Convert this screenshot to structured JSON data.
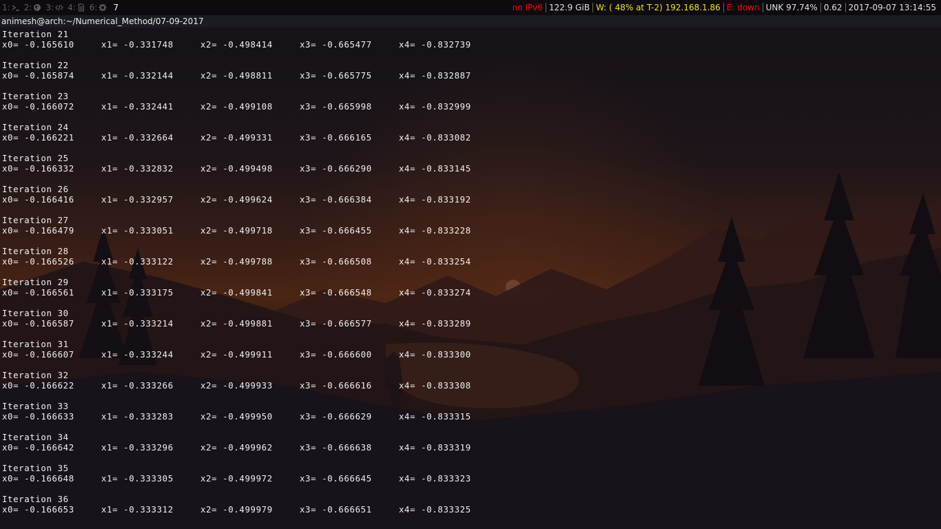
{
  "topbar": {
    "workspaces": [
      {
        "num": "1:",
        "icon": "terminal-icon",
        "active": false
      },
      {
        "num": "2:",
        "icon": "firefox-icon",
        "active": false
      },
      {
        "num": "3:",
        "icon": "code-icon",
        "active": false
      },
      {
        "num": "4:",
        "icon": "document-icon",
        "active": false
      },
      {
        "num": "6:",
        "icon": "gear-icon",
        "active": false
      },
      {
        "num": "7",
        "icon": "",
        "active": true
      }
    ],
    "status": {
      "ipv6": "no IPv6",
      "disk": "122.9 GiB",
      "wireless": "W: ( 48% at T-2) 192.168.1.86",
      "ethernet": "E: down",
      "battery": "UNK 97.74%",
      "load": "0.62",
      "datetime": "2017-09-07 13:14:55"
    },
    "colors": {
      "ipv6": "#ff0000",
      "wireless": "#00ff00",
      "ethernet": "#ff0000",
      "default": "#e0e0e0"
    }
  },
  "window": {
    "title": "animesh@arch:~/Numerical_Method/07-09-2017"
  },
  "terminal": {
    "iterations": [
      {
        "label": "Iteration 21",
        "x0": "x0= -0.165610",
        "x1": "x1= -0.331748",
        "x2": "x2= -0.498414",
        "x3": "x3= -0.665477",
        "x4": "x4= -0.832739"
      },
      {
        "label": "Iteration 22",
        "x0": "x0= -0.165874",
        "x1": "x1= -0.332144",
        "x2": "x2= -0.498811",
        "x3": "x3= -0.665775",
        "x4": "x4= -0.832887"
      },
      {
        "label": "Iteration 23",
        "x0": "x0= -0.166072",
        "x1": "x1= -0.332441",
        "x2": "x2= -0.499108",
        "x3": "x3= -0.665998",
        "x4": "x4= -0.832999"
      },
      {
        "label": "Iteration 24",
        "x0": "x0= -0.166221",
        "x1": "x1= -0.332664",
        "x2": "x2= -0.499331",
        "x3": "x3= -0.666165",
        "x4": "x4= -0.833082"
      },
      {
        "label": "Iteration 25",
        "x0": "x0= -0.166332",
        "x1": "x1= -0.332832",
        "x2": "x2= -0.499498",
        "x3": "x3= -0.666290",
        "x4": "x4= -0.833145"
      },
      {
        "label": "Iteration 26",
        "x0": "x0= -0.166416",
        "x1": "x1= -0.332957",
        "x2": "x2= -0.499624",
        "x3": "x3= -0.666384",
        "x4": "x4= -0.833192"
      },
      {
        "label": "Iteration 27",
        "x0": "x0= -0.166479",
        "x1": "x1= -0.333051",
        "x2": "x2= -0.499718",
        "x3": "x3= -0.666455",
        "x4": "x4= -0.833228"
      },
      {
        "label": "Iteration 28",
        "x0": "x0= -0.166526",
        "x1": "x1= -0.333122",
        "x2": "x2= -0.499788",
        "x3": "x3= -0.666508",
        "x4": "x4= -0.833254"
      },
      {
        "label": "Iteration 29",
        "x0": "x0= -0.166561",
        "x1": "x1= -0.333175",
        "x2": "x2= -0.499841",
        "x3": "x3= -0.666548",
        "x4": "x4= -0.833274"
      },
      {
        "label": "Iteration 30",
        "x0": "x0= -0.166587",
        "x1": "x1= -0.333214",
        "x2": "x2= -0.499881",
        "x3": "x3= -0.666577",
        "x4": "x4= -0.833289"
      },
      {
        "label": "Iteration 31",
        "x0": "x0= -0.166607",
        "x1": "x1= -0.333244",
        "x2": "x2= -0.499911",
        "x3": "x3= -0.666600",
        "x4": "x4= -0.833300"
      },
      {
        "label": "Iteration 32",
        "x0": "x0= -0.166622",
        "x1": "x1= -0.333266",
        "x2": "x2= -0.499933",
        "x3": "x3= -0.666616",
        "x4": "x4= -0.833308"
      },
      {
        "label": "Iteration 33",
        "x0": "x0= -0.166633",
        "x1": "x1= -0.333283",
        "x2": "x2= -0.499950",
        "x3": "x3= -0.666629",
        "x4": "x4= -0.833315"
      },
      {
        "label": "Iteration 34",
        "x0": "x0= -0.166642",
        "x1": "x1= -0.333296",
        "x2": "x2= -0.499962",
        "x3": "x3= -0.666638",
        "x4": "x4= -0.833319"
      },
      {
        "label": "Iteration 35",
        "x0": "x0= -0.166648",
        "x1": "x1= -0.333305",
        "x2": "x2= -0.499972",
        "x3": "x3= -0.666645",
        "x4": "x4= -0.833323"
      },
      {
        "label": "Iteration 36",
        "x0": "x0= -0.166653",
        "x1": "x1= -0.333312",
        "x2": "x2= -0.499979",
        "x3": "x3= -0.666651",
        "x4": "x4= -0.833325"
      }
    ]
  },
  "wallpaper": {
    "name": "firewatch-landscape"
  }
}
